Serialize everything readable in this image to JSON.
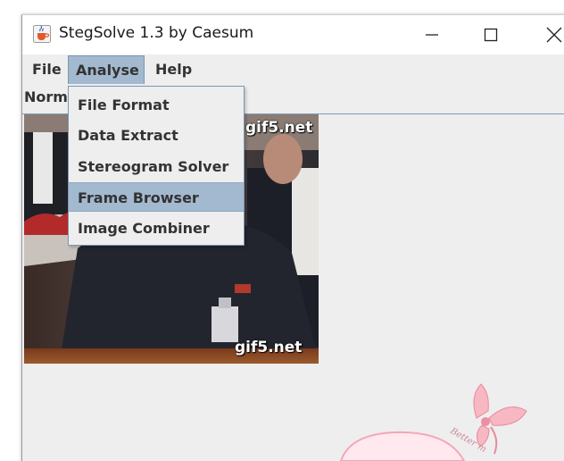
{
  "window": {
    "title": "StegSolve 1.3 by Caesum",
    "icon": "java-cup-icon",
    "controls": [
      "minimize-icon",
      "maximize-icon",
      "close-icon"
    ]
  },
  "menubar": {
    "items": [
      {
        "label": "File"
      },
      {
        "label": "Analyse",
        "active": true
      },
      {
        "label": "Help"
      }
    ]
  },
  "toolbar": {
    "mode_label": "Norm"
  },
  "dropdown": {
    "items": [
      {
        "label": "File Format"
      },
      {
        "label": "Data Extract"
      },
      {
        "label": "Stereogram Solver"
      },
      {
        "label": "Frame Browser",
        "selected": true
      },
      {
        "label": "Image Combiner"
      }
    ]
  },
  "image": {
    "watermark_top": "gif5.net",
    "watermark_bottom": "gif5.net"
  },
  "decoration": {
    "text": "Better m"
  },
  "colors": {
    "menu_highlight": "#a3b9cf",
    "window_bg": "#eeeeee",
    "border_accent": "#7a97b5"
  }
}
